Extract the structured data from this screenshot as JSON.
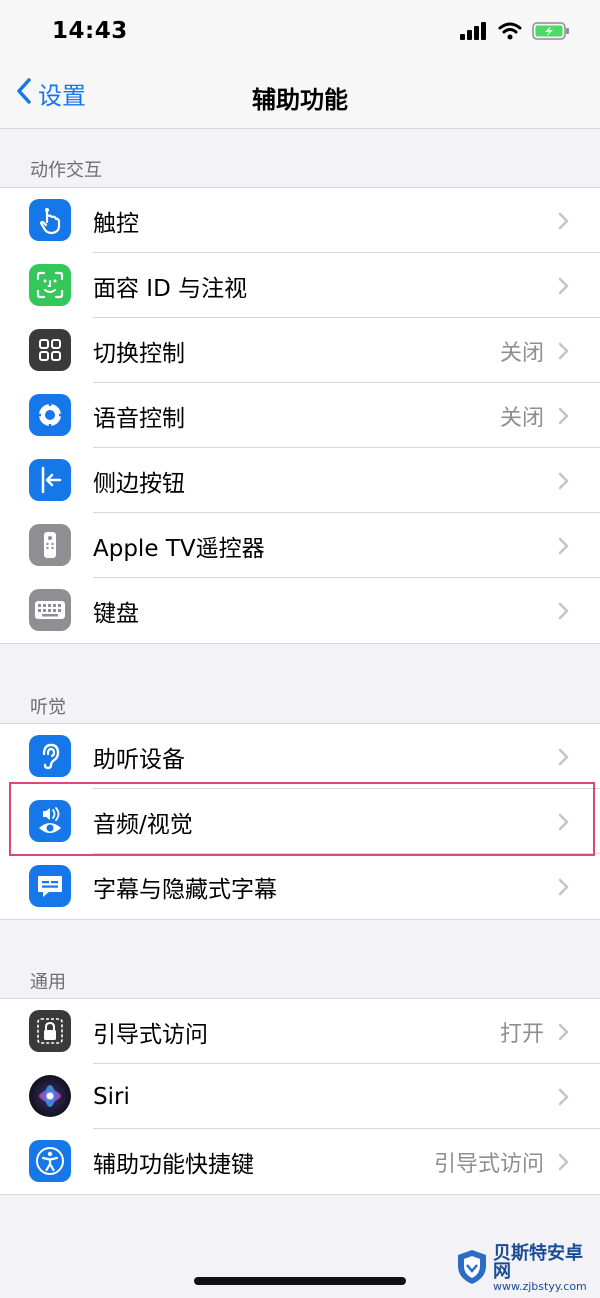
{
  "status_bar": {
    "time": "14:43",
    "icons": [
      "cellular-signal-icon",
      "wifi-icon",
      "battery-charging-icon"
    ],
    "battery_color": "#4cd964"
  },
  "nav": {
    "back_label": "设置",
    "title": "辅助功能",
    "accent_color": "#1677e8"
  },
  "sections": {
    "interaction": {
      "header": "动作交互",
      "items": [
        {
          "label": "触控",
          "value": "",
          "icon": "touch-hand-icon",
          "color": "#1677e8"
        },
        {
          "label": "面容 ID 与注视",
          "value": "",
          "icon": "face-id-icon",
          "color": "#34c759"
        },
        {
          "label": "切换控制",
          "value": "关闭",
          "icon": "switch-control-icon",
          "color": "#3a3a3c"
        },
        {
          "label": "语音控制",
          "value": "关闭",
          "icon": "voice-control-icon",
          "color": "#1677e8"
        },
        {
          "label": "侧边按钮",
          "value": "",
          "icon": "side-button-icon",
          "color": "#1677e8"
        },
        {
          "label": "Apple TV遥控器",
          "value": "",
          "icon": "apple-tv-remote-icon",
          "color": "#8e8e93"
        },
        {
          "label": "键盘",
          "value": "",
          "icon": "keyboard-icon",
          "color": "#8e8e93"
        }
      ]
    },
    "hearing": {
      "header": "听觉",
      "items": [
        {
          "label": "助听设备",
          "value": "",
          "icon": "ear-icon",
          "color": "#1677e8"
        },
        {
          "label": "音频/视觉",
          "value": "",
          "icon": "audio-visual-icon",
          "color": "#1677e8"
        },
        {
          "label": "字幕与隐藏式字幕",
          "value": "",
          "icon": "subtitles-icon",
          "color": "#1677e8"
        }
      ]
    },
    "general": {
      "header": "通用",
      "items": [
        {
          "label": "引导式访问",
          "value": "打开",
          "icon": "guided-access-lock-icon",
          "color": "#3a3a3c"
        },
        {
          "label": "Siri",
          "value": "",
          "icon": "siri-icon",
          "color": "#1c1c2e"
        },
        {
          "label": "辅助功能快捷键",
          "value": "引导式访问",
          "icon": "accessibility-icon",
          "color": "#1677e8"
        }
      ]
    }
  },
  "watermark": {
    "name": "贝斯特安卓网",
    "url": "www.zjbstyy.com"
  }
}
